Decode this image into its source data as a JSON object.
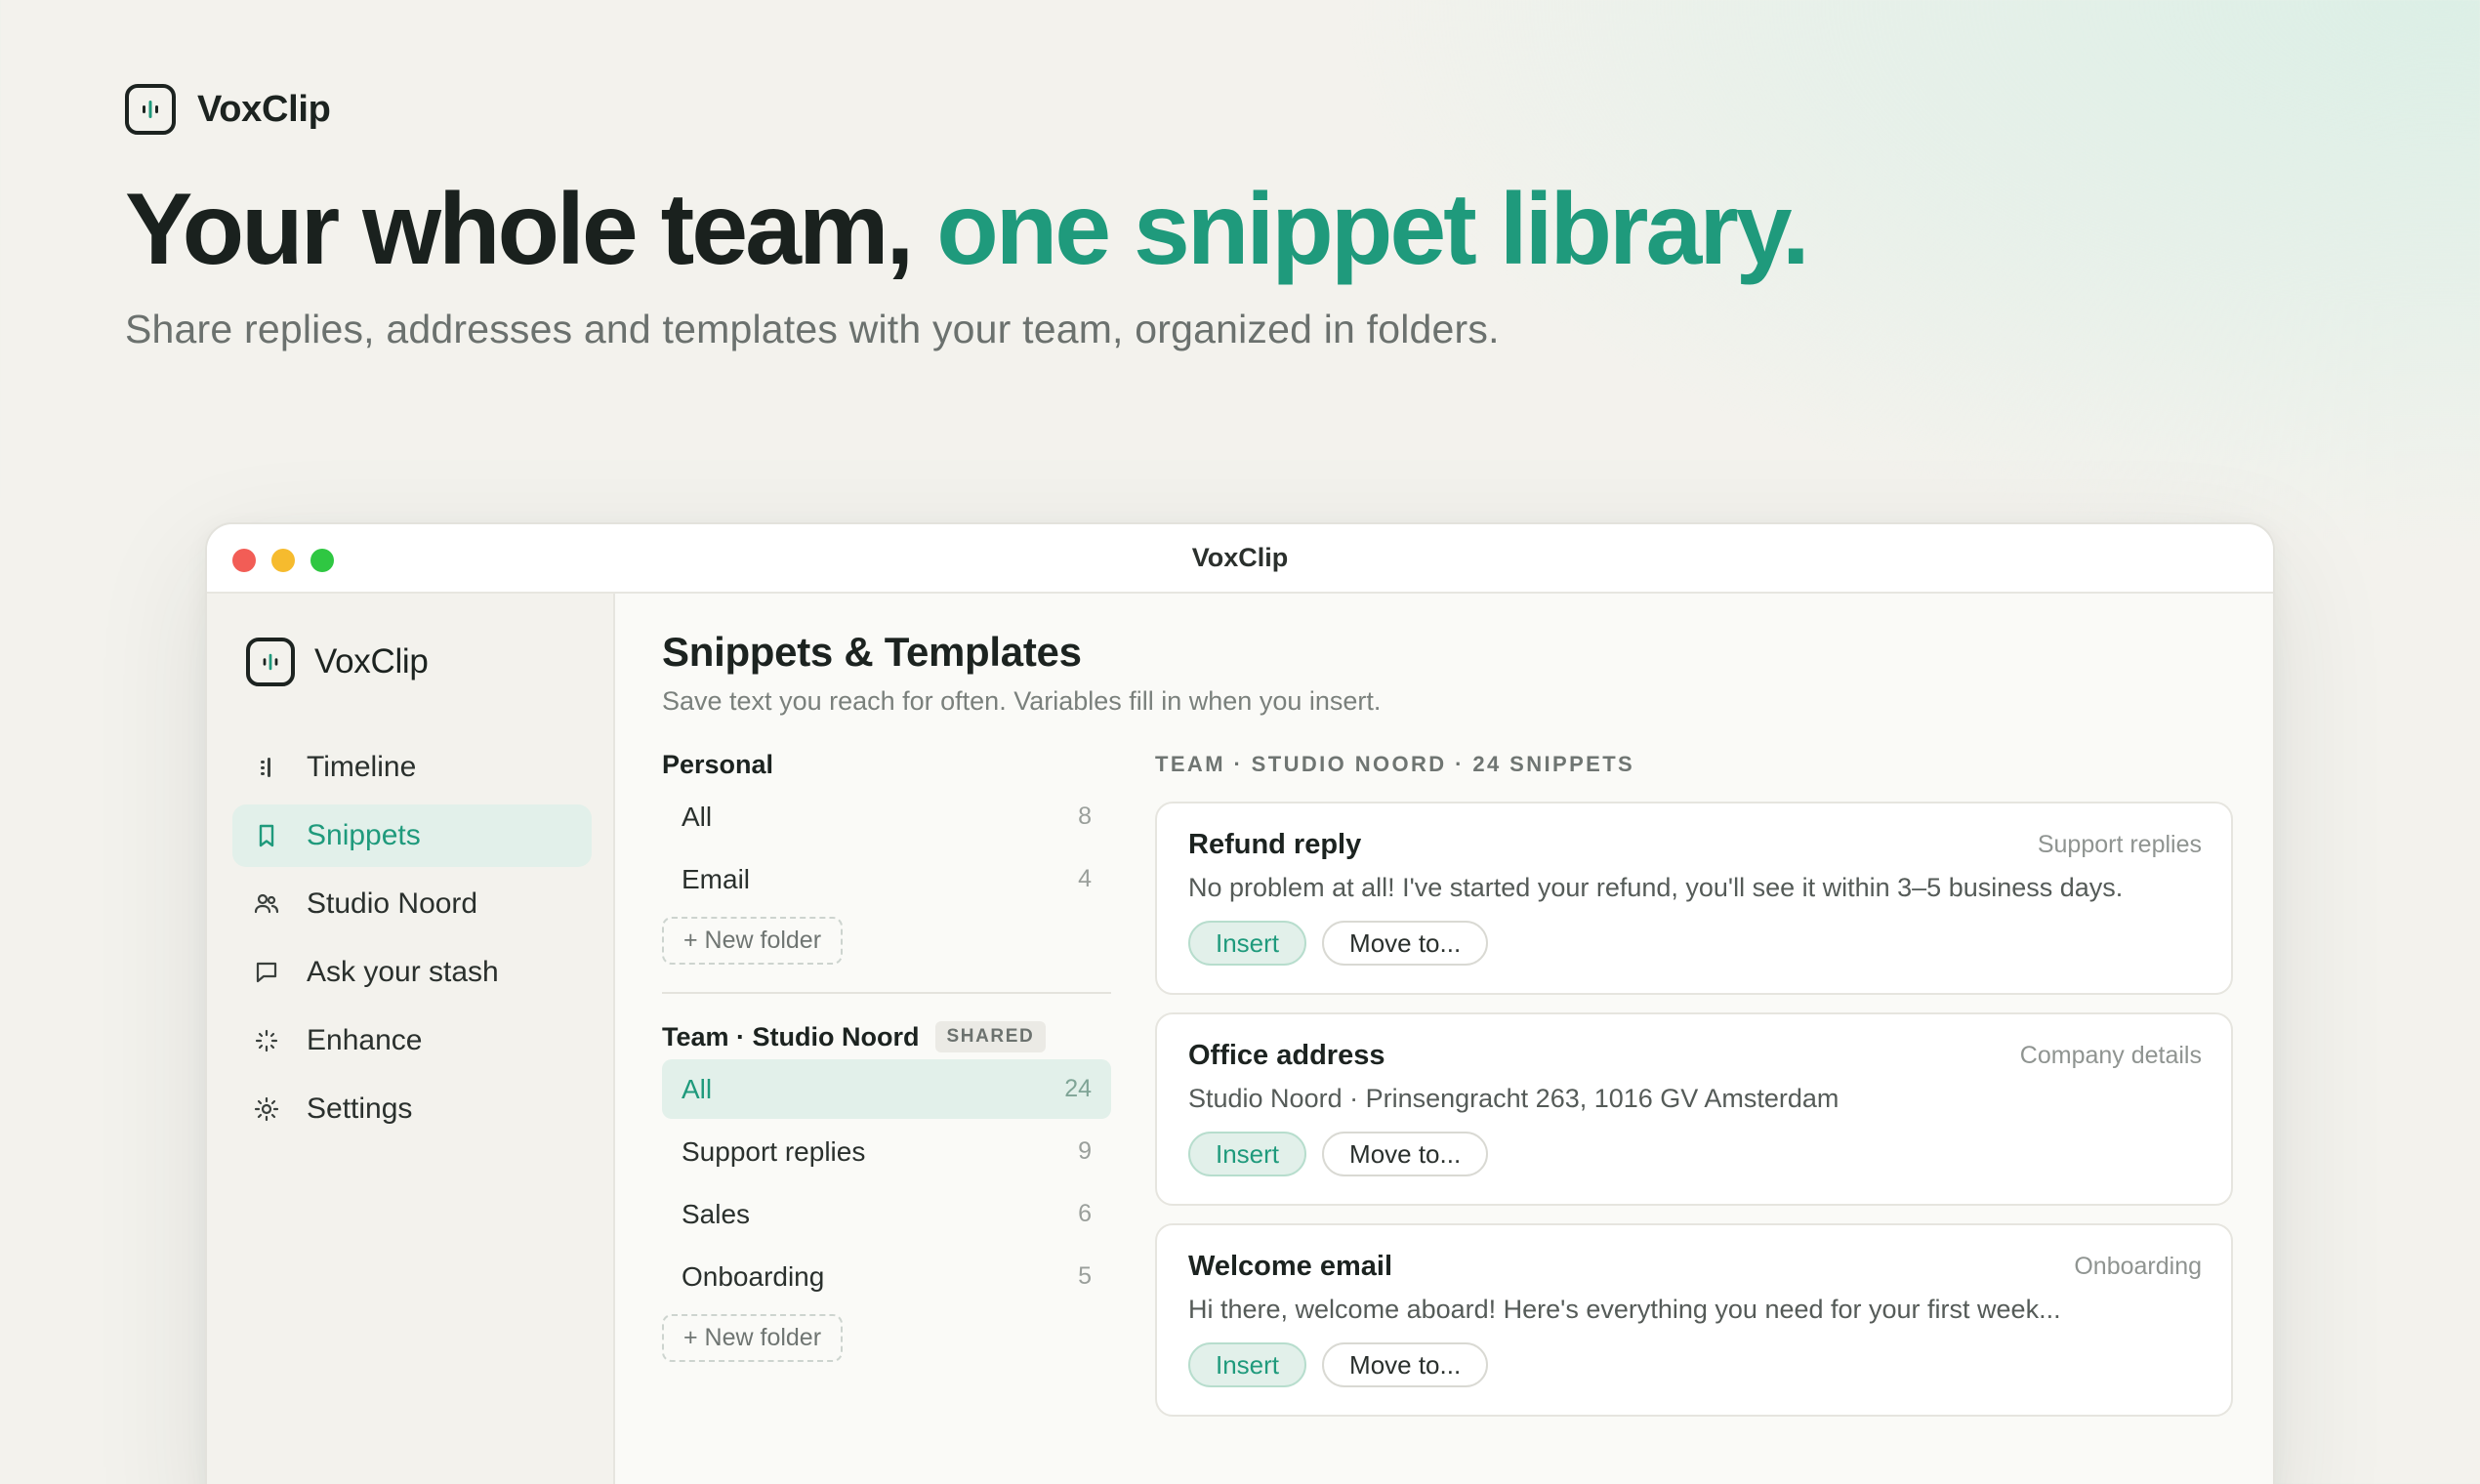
{
  "hero": {
    "brand_name": "VoxClip",
    "headline_main": "Your whole team, ",
    "headline_accent": "one snippet library.",
    "subhead": "Share replies, addresses and templates with your team, organized in folders."
  },
  "window": {
    "title": "VoxClip"
  },
  "sidebar": {
    "brand_name": "VoxClip",
    "items": [
      {
        "label": "Timeline",
        "icon": "timeline-icon",
        "active": false
      },
      {
        "label": "Snippets",
        "icon": "bookmark-icon",
        "active": true
      },
      {
        "label": "Studio Noord",
        "icon": "users-icon",
        "active": false
      },
      {
        "label": "Ask your stash",
        "icon": "chat-icon",
        "active": false
      },
      {
        "label": "Enhance",
        "icon": "sparkle-icon",
        "active": false
      },
      {
        "label": "Settings",
        "icon": "gear-icon",
        "active": false
      }
    ]
  },
  "main": {
    "title": "Snippets & Templates",
    "subtitle": "Save text you reach for often. Variables fill in when you insert.",
    "personal": {
      "label": "Personal",
      "folders": [
        {
          "name": "All",
          "count": "8"
        },
        {
          "name": "Email",
          "count": "4"
        }
      ],
      "new_folder": "+ New folder"
    },
    "team": {
      "label": "Team · Studio Noord",
      "badge": "SHARED",
      "folders": [
        {
          "name": "All",
          "count": "24",
          "active": true
        },
        {
          "name": "Support replies",
          "count": "9"
        },
        {
          "name": "Sales",
          "count": "6"
        },
        {
          "name": "Onboarding",
          "count": "5"
        }
      ],
      "new_folder": "+ New folder"
    },
    "list_heading": "TEAM · STUDIO NOORD · 24 SNIPPETS",
    "snippets": [
      {
        "title": "Refund reply",
        "folder": "Support replies",
        "body": "No problem at all! I've started your refund, you'll see it within 3–5 business days.",
        "insert_label": "Insert",
        "move_label": "Move to..."
      },
      {
        "title": "Office address",
        "folder": "Company details",
        "body": "Studio Noord · Prinsengracht 263, 1016 GV Amsterdam",
        "insert_label": "Insert",
        "move_label": "Move to..."
      },
      {
        "title": "Welcome email",
        "folder": "Onboarding",
        "body": "Hi there, welcome aboard! Here's everything you need for your first week...",
        "insert_label": "Insert",
        "move_label": "Move to..."
      }
    ]
  },
  "colors": {
    "accent": "#1f9a7c",
    "accent_bg": "#e2f0ea",
    "text": "#1c2320",
    "muted": "#6b716e"
  }
}
